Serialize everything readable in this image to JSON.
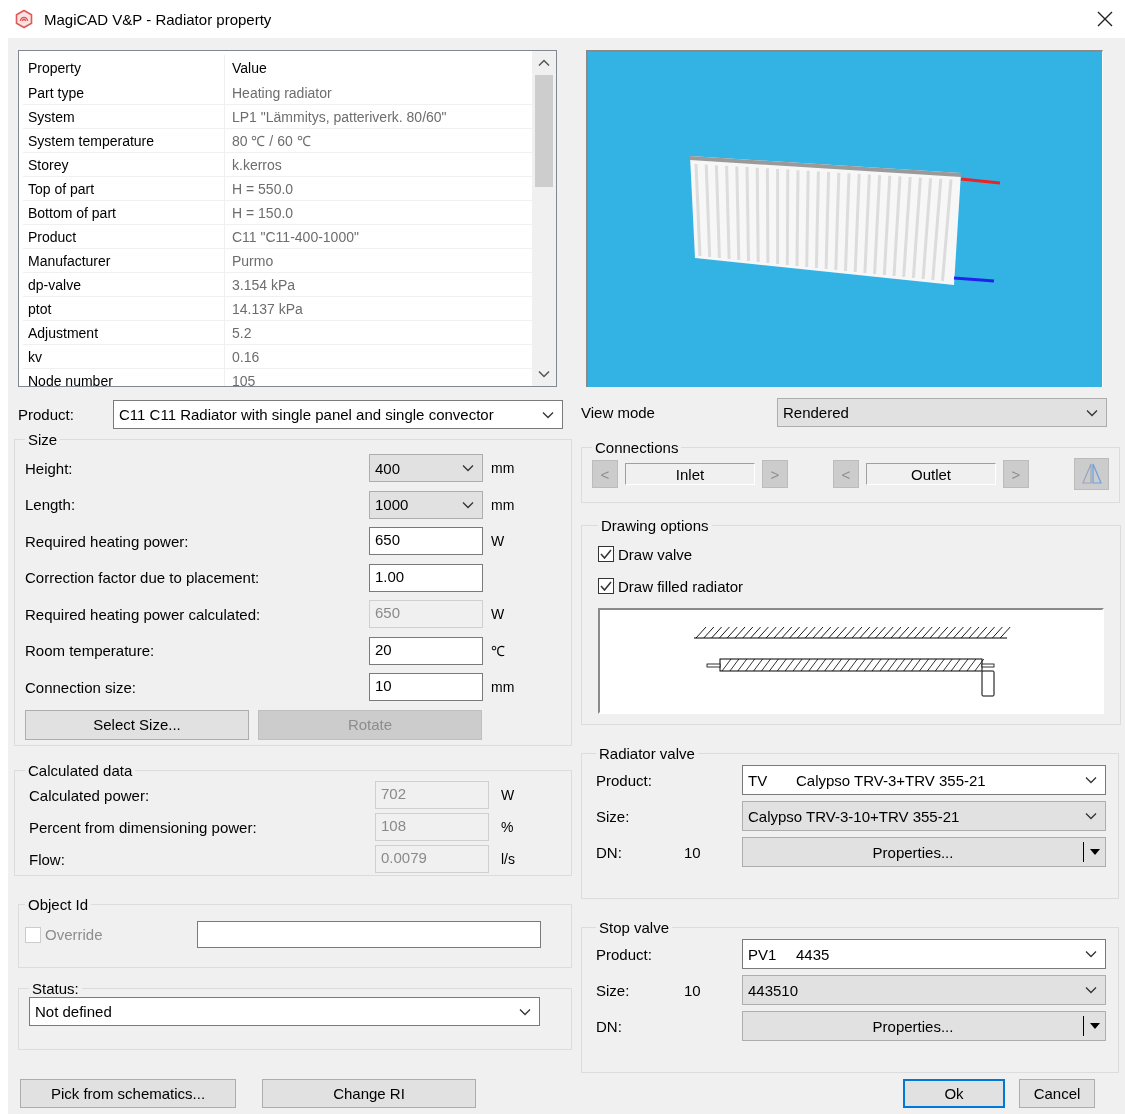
{
  "window": {
    "title": "MagiCAD V&P - Radiator property"
  },
  "property_table": {
    "columns": [
      "Property",
      "Value"
    ],
    "rows": [
      [
        "Part type",
        "Heating radiator"
      ],
      [
        "System",
        "LP1 \"Lämmitys, patteriverk. 80/60\""
      ],
      [
        "System temperature",
        "80 ℃ / 60 ℃"
      ],
      [
        "Storey",
        "k.kerros"
      ],
      [
        "Top of part",
        "H = 550.0"
      ],
      [
        "Bottom of part",
        "H = 150.0"
      ],
      [
        "Product",
        "C11 \"C11-400-1000\""
      ],
      [
        "Manufacturer",
        "Purmo"
      ],
      [
        "dp-valve",
        "3.154 kPa"
      ],
      [
        "ptot",
        "14.137 kPa"
      ],
      [
        "Adjustment",
        "5.2"
      ],
      [
        "kv",
        "0.16"
      ],
      [
        "Node number",
        "105"
      ]
    ]
  },
  "product": {
    "label": "Product:",
    "value": "C11 C11 Radiator with single panel and single convector"
  },
  "size": {
    "title": "Size",
    "fields": [
      {
        "label": "Height:",
        "kind": "dropdown",
        "value": "400",
        "unit": "mm",
        "disabled": false
      },
      {
        "label": "Length:",
        "kind": "dropdown",
        "value": "1000",
        "unit": "mm",
        "disabled": false
      },
      {
        "label": "Required heating power:",
        "kind": "input",
        "value": "650",
        "unit": "W",
        "disabled": false
      },
      {
        "label": "Correction factor due to placement:",
        "kind": "input",
        "value": "1.00",
        "disabled": false
      },
      {
        "label": "Required heating power calculated:",
        "kind": "input",
        "value": "650",
        "unit": "W",
        "disabled": true
      },
      {
        "label": "Room temperature:",
        "kind": "input",
        "value": "20",
        "unit": "℃",
        "disabled": false
      },
      {
        "label": "Connection size:",
        "kind": "input",
        "value": "10",
        "unit": "mm",
        "disabled": false
      }
    ],
    "buttons": [
      {
        "label": "Select Size...",
        "disabled": false
      },
      {
        "label": "Rotate",
        "disabled": true
      }
    ]
  },
  "calculated_data": {
    "title": "Calculated data",
    "fields": [
      {
        "label": "Calculated power:",
        "value": "702",
        "unit": "W",
        "disabled": true
      },
      {
        "label": "Percent from dimensioning power:",
        "value": "108",
        "unit": "%",
        "disabled": true
      },
      {
        "label": "Flow:",
        "value": "0.0079",
        "unit": "l/s",
        "disabled": true
      }
    ]
  },
  "object_id": {
    "title": "Object Id",
    "override": {
      "label": "Override",
      "checked": false,
      "disabled": true
    }
  },
  "status": {
    "title": "Status:",
    "value": "Not defined"
  },
  "left_buttons": [
    {
      "label": "Pick from schematics..."
    },
    {
      "label": "Change RI"
    }
  ],
  "view_mode": {
    "label": "View mode",
    "value": "Rendered"
  },
  "connections": {
    "title": "Connections",
    "items": [
      {
        "prev": {
          "text": "<",
          "disabled": true
        },
        "label": "Inlet",
        "next": {
          "text": ">",
          "disabled": true
        }
      },
      {
        "prev": {
          "text": "<",
          "disabled": true
        },
        "label": "Outlet",
        "next": {
          "text": ">",
          "disabled": true
        }
      }
    ],
    "mirror_disabled": true
  },
  "drawing_options": {
    "title": "Drawing options",
    "options": [
      {
        "label": "Draw valve",
        "checked": true
      },
      {
        "label": "Draw filled radiator",
        "checked": true
      }
    ]
  },
  "radiator_valve": {
    "title": "Radiator valve",
    "rows": [
      {
        "label": "Product:",
        "kind": "combo",
        "code": "TV",
        "value": "Calypso TRV-3+TRV 355-21"
      },
      {
        "label": "Size:",
        "kind": "dropdown",
        "value": "Calypso TRV-3-10+TRV 355-21"
      },
      {
        "label": "DN:",
        "number": "10",
        "kind": "split_button",
        "value": "Properties..."
      }
    ]
  },
  "stop_valve": {
    "title": "Stop valve",
    "rows": [
      {
        "label": "Product:",
        "kind": "combo",
        "code": "PV1",
        "value": "4435"
      },
      {
        "label": "Size:",
        "number": "10",
        "kind": "dropdown",
        "value": "443510"
      },
      {
        "label": "DN:",
        "kind": "split_button",
        "value": "Properties..."
      }
    ]
  },
  "dialog_buttons": [
    {
      "label": "Ok",
      "default": true
    },
    {
      "label": "Cancel",
      "default": false
    }
  ]
}
